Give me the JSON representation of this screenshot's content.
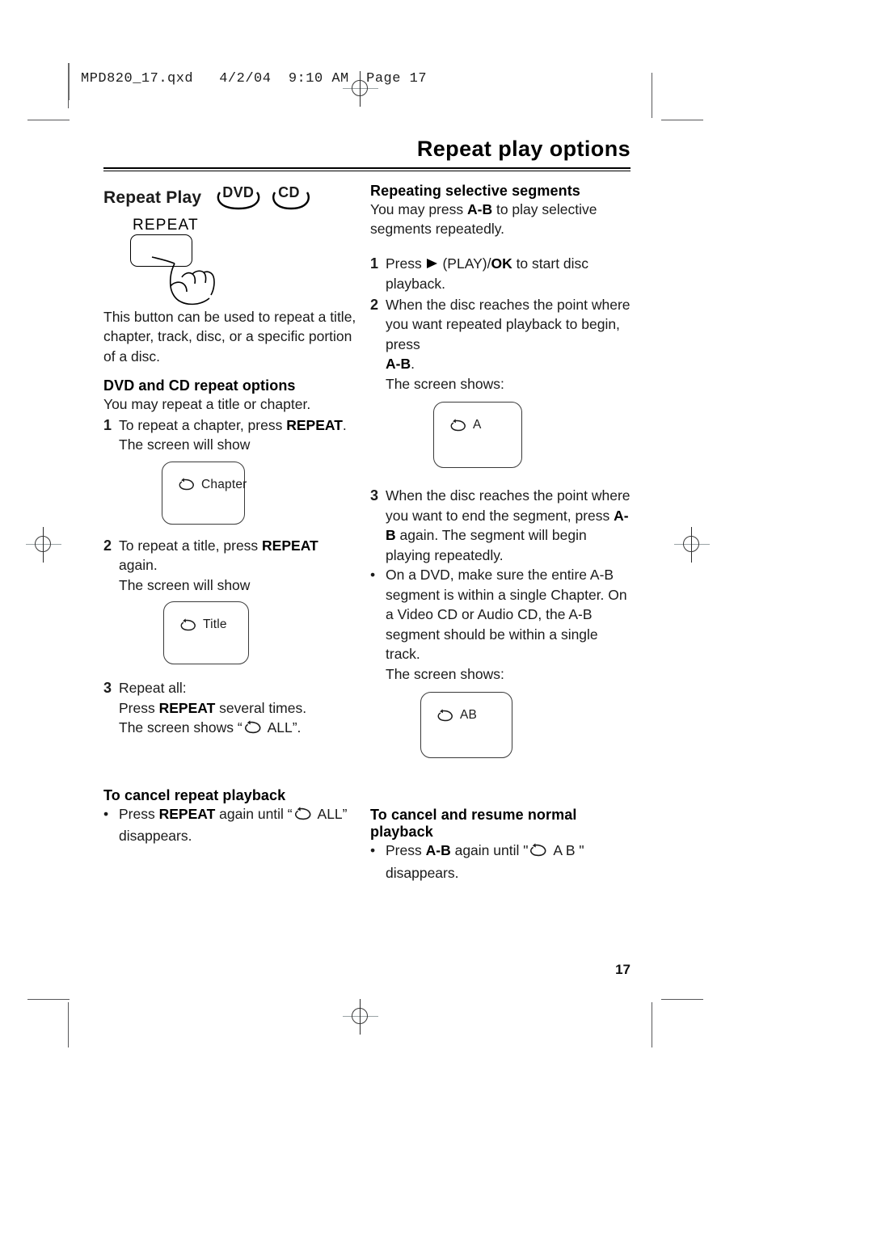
{
  "print_slug": "MPD820_17.qxd   4/2/04  9:10 AM  Page 17",
  "chapter_title": "Repeat play options",
  "left_column": {
    "section_heading": "Repeat Play",
    "disc_badges": [
      {
        "label": "DVD",
        "icon": "dvd-disc-badge"
      },
      {
        "label": "CD",
        "icon": "cd-disc-badge"
      }
    ],
    "button_illustration": {
      "button_label": "REPEAT",
      "icon": "hand-pressing-button-icon"
    },
    "intro_paragraph": "This button can be used to repeat a title, chapter, track, disc, or a specific portion of a disc.",
    "subheading": "DVD and CD repeat options",
    "subheading_intro": "You may repeat a title or chapter.",
    "step1": {
      "number": "1",
      "line1_a": "To repeat a chapter, press ",
      "line1_b": "REPEAT",
      "line1_c": ".",
      "line2": "The screen will show"
    },
    "screen_chapter": {
      "icon": "repeat-loop-icon",
      "label": "Chapter"
    },
    "step2": {
      "number": "2",
      "line1_a": "To repeat a title, press ",
      "line1_b": "REPEAT",
      "line1_c": " again.",
      "line2": "The screen will show"
    },
    "screen_title": {
      "icon": "repeat-loop-icon",
      "label": "Title"
    },
    "step3": {
      "number": "3",
      "line1": "Repeat all:",
      "line2_a": "Press ",
      "line2_b": "REPEAT",
      "line2_c": " several times.",
      "line3_a": "The screen shows “",
      "line3_icon": "repeat-loop-icon",
      "line3_b": "ALL”."
    },
    "cancel_heading": "To cancel repeat playback",
    "cancel_bullet": {
      "dot": "•",
      "a": "Press ",
      "b": "REPEAT",
      "c": " again until “",
      "icon": "repeat-loop-icon",
      "d": "ALL”",
      "e": "disappears."
    }
  },
  "right_column": {
    "subheading": "Repeating selective segments",
    "intro_a": "You may press ",
    "intro_b": "A-B",
    "intro_c": " to play selective segments repeatedly.",
    "step1": {
      "number": "1",
      "a": "Press ",
      "play_icon": "play-triangle-icon",
      "b": " (PLAY)/",
      "c": "OK",
      "d": " to start disc playback."
    },
    "step2": {
      "number": "2",
      "line1": "When the disc reaches the point where you want repeated playback to begin, press",
      "line2_b": "A-B",
      "line2_c": ".",
      "line3": "The screen shows:"
    },
    "screen_a": {
      "icon": "repeat-loop-icon",
      "label": "A"
    },
    "step3": {
      "number": "3",
      "line1": "When the disc reaches the point where you want to end the segment, press ",
      "line1_b": "A-B",
      "line2": "again. The segment will begin playing repeatedly."
    },
    "note_bullet": {
      "dot": "•",
      "text": "On a DVD, make sure the entire A-B segment is within a single Chapter. On a Video CD or Audio CD, the A-B segment should be within a single track.",
      "screen_shows": "The screen shows:"
    },
    "screen_ab": {
      "icon": "repeat-loop-icon",
      "label": "AB"
    },
    "cancel_heading": "To cancel and resume normal playback",
    "cancel_bullet": {
      "dot": "•",
      "a": "Press ",
      "b": "A-B",
      "c": " again until \"",
      "icon": "repeat-loop-icon",
      "d": "A B \"",
      "e": "disappears."
    }
  },
  "page_number": "17"
}
